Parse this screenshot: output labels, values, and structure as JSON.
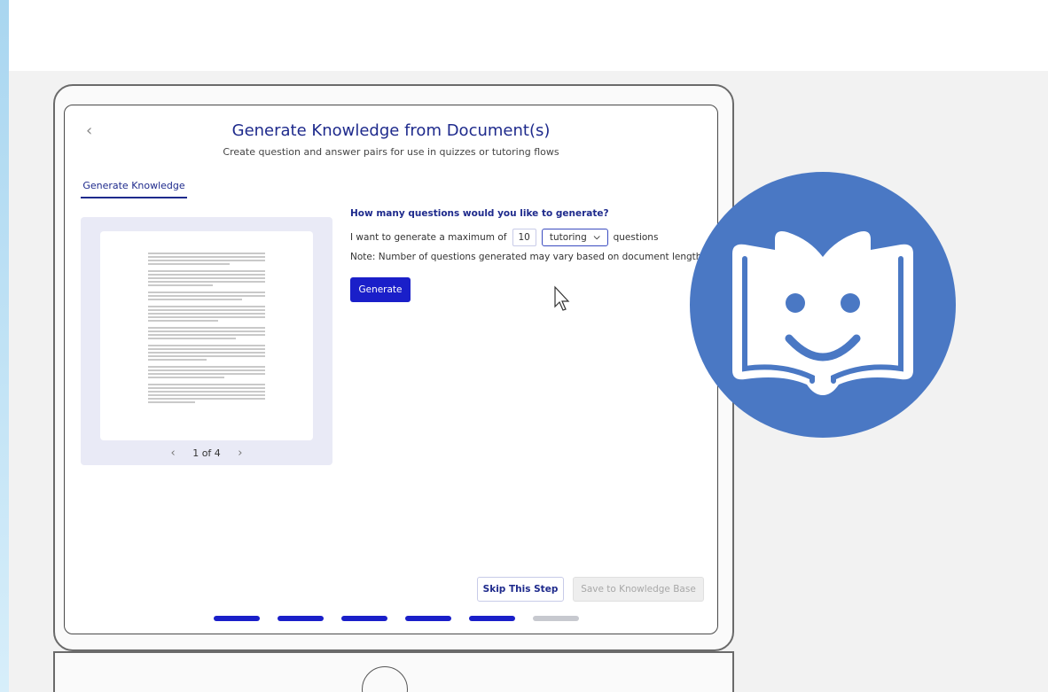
{
  "page": {
    "title": "Generate Knowledge from Document(s)",
    "subtitle": "Create question and answer pairs for use in quizzes or tutoring flows",
    "back_icon": "chevron-left-icon"
  },
  "tabs": [
    {
      "label": "Generate Knowledge",
      "active": true
    }
  ],
  "preview": {
    "page_indicator": "1 of 4",
    "prev_icon": "chevron-left-icon",
    "next_icon": "chevron-right-icon"
  },
  "form": {
    "question": "How many questions would you like to generate?",
    "prefix": "I want to generate a maximum of",
    "count_value": "10",
    "type_selected": "tutoring",
    "suffix": "questions",
    "note": "Note: Number of questions generated may vary based on document length.",
    "generate_label": "Generate"
  },
  "footer": {
    "skip_label": "Skip This Step",
    "save_label": "Save to Knowledge Base",
    "progress_steps_total": 6,
    "progress_steps_done": 5
  },
  "colors": {
    "brand_blue": "#1a1fc9",
    "title_navy": "#1e2a8c",
    "logo_blue": "#4a78c4"
  },
  "logo_icon": "smiling-open-book-icon"
}
